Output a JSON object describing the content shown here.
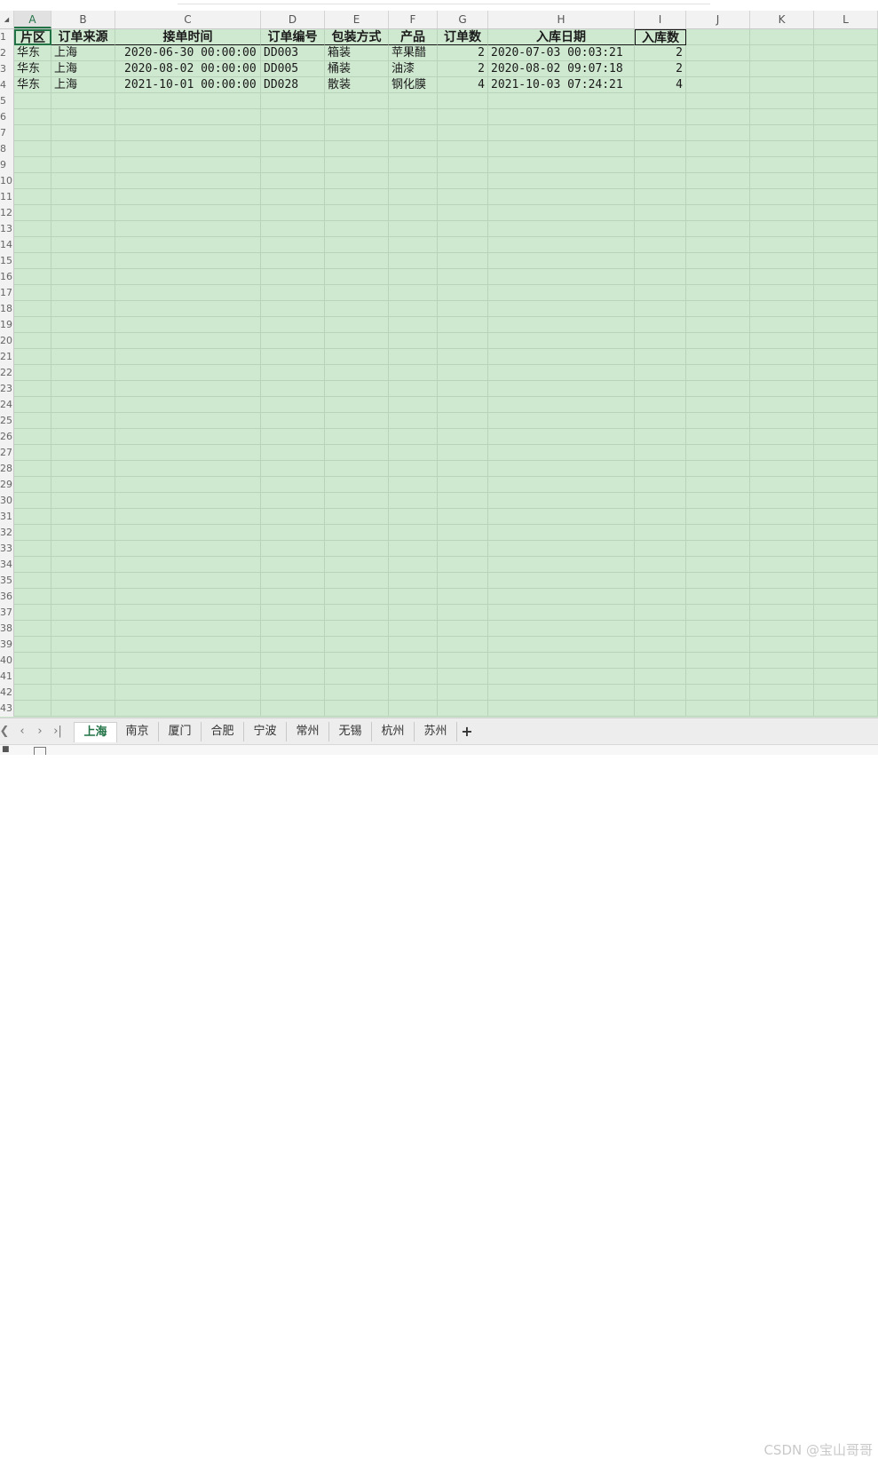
{
  "columns": [
    "A",
    "B",
    "C",
    "D",
    "E",
    "F",
    "G",
    "H",
    "I",
    "J",
    "K",
    "L"
  ],
  "header_row": [
    "片区",
    "订单来源",
    "接单时间",
    "订单编号",
    "包装方式",
    "产品",
    "订单数",
    "入库日期",
    "入库数"
  ],
  "rows": [
    [
      "华东",
      "上海",
      "2020-06-30 00:00:00",
      "DD003",
      "箱装",
      "苹果醋",
      "2",
      "2020-07-03 00:03:21",
      "2"
    ],
    [
      "华东",
      "上海",
      "2020-08-02 00:00:00",
      "DD005",
      "桶装",
      "油漆",
      "2",
      "2020-08-02 09:07:18",
      "2"
    ],
    [
      "华东",
      "上海",
      "2021-10-01 00:00:00",
      "DD028",
      "散装",
      "钢化膜",
      "4",
      "2021-10-03 07:24:21",
      "4"
    ]
  ],
  "row_numbers": [
    "1",
    "2",
    "3",
    "4",
    "5",
    "6",
    "7",
    "8",
    "9",
    "10",
    "11",
    "12",
    "13",
    "14",
    "15",
    "16",
    "17",
    "18",
    "19",
    "20",
    "21",
    "22",
    "23",
    "24",
    "25",
    "26",
    "27",
    "28",
    "29",
    "30",
    "31",
    "32",
    "33",
    "34",
    "35",
    "36",
    "37",
    "38",
    "39",
    "40",
    "41",
    "42",
    "43"
  ],
  "sheet_tabs": [
    "上海",
    "南京",
    "厦门",
    "合肥",
    "宁波",
    "常州",
    "无锡",
    "杭州",
    "苏州"
  ],
  "active_tab": "上海",
  "add_tab_label": "+",
  "nav_icons": [
    "first-sheet-icon",
    "prev-sheet-icon",
    "next-sheet-icon",
    "last-sheet-icon"
  ],
  "watermark": "CSDN @宝山哥哥",
  "colors": {
    "grid_bg": "#cfe8d0",
    "accent": "#217346"
  }
}
